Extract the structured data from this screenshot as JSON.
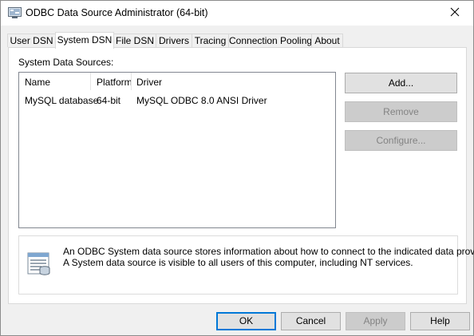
{
  "window": {
    "title": "ODBC Data Source Administrator (64-bit)"
  },
  "tabs": [
    {
      "label": "User DSN"
    },
    {
      "label": "System DSN"
    },
    {
      "label": "File DSN"
    },
    {
      "label": "Drivers"
    },
    {
      "label": "Tracing"
    },
    {
      "label": "Connection Pooling"
    },
    {
      "label": "About"
    }
  ],
  "active_tab": "System DSN",
  "system_dsn": {
    "label": "System Data Sources:",
    "columns": [
      "Name",
      "Platform",
      "Driver"
    ],
    "rows": [
      {
        "name": "MySQL database",
        "platform": "64-bit",
        "driver": "MySQL ODBC 8.0 ANSI Driver"
      }
    ],
    "buttons": {
      "add": "Add...",
      "remove": "Remove",
      "configure": "Configure..."
    },
    "info_line1": "An ODBC System data source stores information about how to connect to the indicated data provider.",
    "info_line2": "A System data source is visible to all users of this computer, including NT services."
  },
  "footer": {
    "ok": "OK",
    "cancel": "Cancel",
    "apply": "Apply",
    "help": "Help"
  },
  "colors": {
    "accent": "#0078d7",
    "disabled_text": "#838383"
  }
}
